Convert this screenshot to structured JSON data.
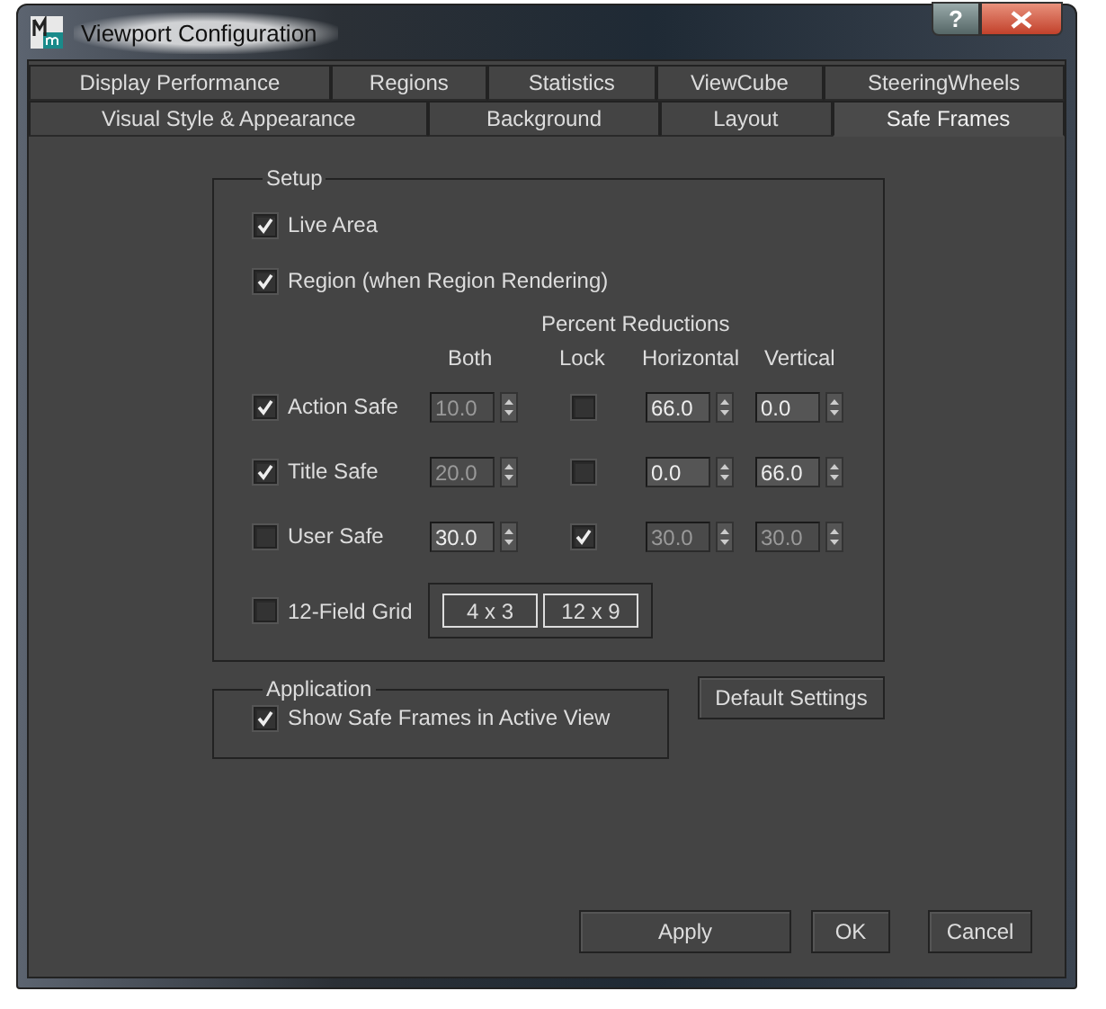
{
  "window": {
    "title": "Viewport Configuration",
    "help_button": "?"
  },
  "tab_rows": [
    [
      {
        "label": "Display Performance",
        "selected": false
      },
      {
        "label": "Regions",
        "selected": false
      },
      {
        "label": "Statistics",
        "selected": false
      },
      {
        "label": "ViewCube",
        "selected": false
      },
      {
        "label": "SteeringWheels",
        "selected": false
      }
    ],
    [
      {
        "label": "Visual Style & Appearance",
        "selected": false
      },
      {
        "label": "Background",
        "selected": false
      },
      {
        "label": "Layout",
        "selected": false
      },
      {
        "label": "Safe Frames",
        "selected": true
      }
    ]
  ],
  "setup": {
    "title": "Setup",
    "options": [
      {
        "label": "Live Area",
        "checked": true
      },
      {
        "label": "Region (when Region Rendering)",
        "checked": true
      }
    ],
    "group_heading": "Percent Reductions",
    "columns": [
      "Both",
      "Lock",
      "Horizontal",
      "Vertical"
    ],
    "frames": [
      {
        "label": "Action Safe",
        "checked": true,
        "both": {
          "value": "10.0",
          "disabled": true
        },
        "lock": false,
        "horizontal": {
          "value": "66.0",
          "disabled": false
        },
        "vertical": {
          "value": "0.0",
          "disabled": false
        }
      },
      {
        "label": "Title Safe",
        "checked": true,
        "both": {
          "value": "20.0",
          "disabled": true
        },
        "lock": false,
        "horizontal": {
          "value": "0.0",
          "disabled": false
        },
        "vertical": {
          "value": "66.0",
          "disabled": false
        }
      },
      {
        "label": "User Safe",
        "checked": false,
        "both": {
          "value": "30.0",
          "disabled": false
        },
        "lock": true,
        "horizontal": {
          "value": "30.0",
          "disabled": true
        },
        "vertical": {
          "value": "30.0",
          "disabled": true
        }
      }
    ],
    "grid": {
      "label": "12-Field Grid",
      "checked": false,
      "buttons": [
        "4 x 3",
        "12 x 9"
      ]
    }
  },
  "application": {
    "title": "Application",
    "options": [
      {
        "label": "Show Safe Frames in Active View",
        "checked": true
      }
    ]
  },
  "default_button": "Default Settings",
  "buttons": [
    "Apply",
    "OK",
    "Cancel"
  ]
}
